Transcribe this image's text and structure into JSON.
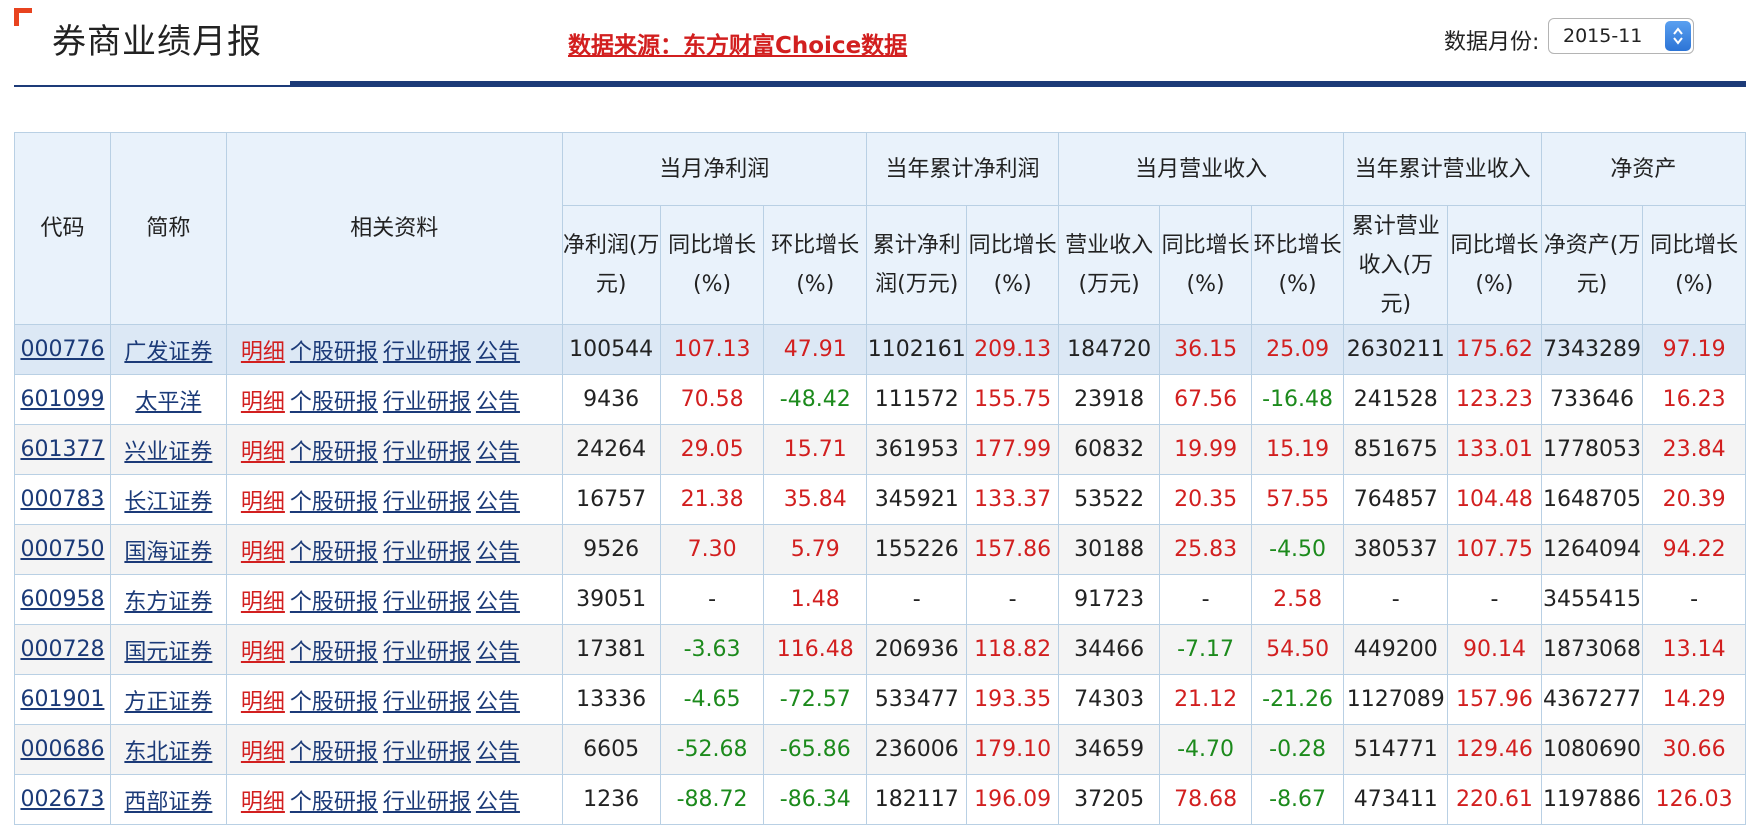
{
  "header": {
    "title": "券商业绩月报",
    "source_link": "数据来源：东方财富Choice数据",
    "month_label": "数据月份:",
    "month_value": "2015-11"
  },
  "colors": {
    "accent": "#1d3b78",
    "positive": "#d21f1f",
    "negative": "#1c8a1c",
    "header_bg": "#e9f2fb"
  },
  "table": {
    "group_headers": {
      "code": "代码",
      "name": "简称",
      "resources": "相关资料",
      "monthly_profit": "当月净利润",
      "ytd_profit": "当年累计净利润",
      "monthly_revenue": "当月营业收入",
      "ytd_revenue": "当年累计营业收入",
      "net_assets": "净资产"
    },
    "sub_headers": {
      "mp_value": "净利润(万元)",
      "mp_yoy": "同比增长(%)",
      "mp_mom": "环比增长(%)",
      "yp_value": "累计净利润(万元)",
      "yp_yoy": "同比增长(%)",
      "mr_value": "营业收入(万元)",
      "mr_yoy": "同比增长(%)",
      "mr_mom": "环比增长(%)",
      "yr_value": "累计营业收入(万元)",
      "yr_yoy": "同比增长(%)",
      "na_value": "净资产(万元)",
      "na_yoy": "同比增长(%)"
    },
    "resource_links": [
      "明细",
      "个股研报",
      "行业研报",
      "公告"
    ],
    "rows": [
      {
        "code": "000776",
        "name": "广发证券",
        "mp": "100544",
        "mp_yoy": "107.13",
        "mp_mom": "47.91",
        "yp": "1102161",
        "yp_yoy": "209.13",
        "mr": "184720",
        "mr_yoy": "36.15",
        "mr_mom": "25.09",
        "yr": "2630211",
        "yr_yoy": "175.62",
        "na": "7343289",
        "na_yoy": "97.19"
      },
      {
        "code": "601099",
        "name": "太平洋",
        "mp": "9436",
        "mp_yoy": "70.58",
        "mp_mom": "-48.42",
        "yp": "111572",
        "yp_yoy": "155.75",
        "mr": "23918",
        "mr_yoy": "67.56",
        "mr_mom": "-16.48",
        "yr": "241528",
        "yr_yoy": "123.23",
        "na": "733646",
        "na_yoy": "16.23"
      },
      {
        "code": "601377",
        "name": "兴业证券",
        "mp": "24264",
        "mp_yoy": "29.05",
        "mp_mom": "15.71",
        "yp": "361953",
        "yp_yoy": "177.99",
        "mr": "60832",
        "mr_yoy": "19.99",
        "mr_mom": "15.19",
        "yr": "851675",
        "yr_yoy": "133.01",
        "na": "1778053",
        "na_yoy": "23.84"
      },
      {
        "code": "000783",
        "name": "长江证券",
        "mp": "16757",
        "mp_yoy": "21.38",
        "mp_mom": "35.84",
        "yp": "345921",
        "yp_yoy": "133.37",
        "mr": "53522",
        "mr_yoy": "20.35",
        "mr_mom": "57.55",
        "yr": "764857",
        "yr_yoy": "104.48",
        "na": "1648705",
        "na_yoy": "20.39"
      },
      {
        "code": "000750",
        "name": "国海证券",
        "mp": "9526",
        "mp_yoy": "7.30",
        "mp_mom": "5.79",
        "yp": "155226",
        "yp_yoy": "157.86",
        "mr": "30188",
        "mr_yoy": "25.83",
        "mr_mom": "-4.50",
        "yr": "380537",
        "yr_yoy": "107.75",
        "na": "1264094",
        "na_yoy": "94.22"
      },
      {
        "code": "600958",
        "name": "东方证券",
        "mp": "39051",
        "mp_yoy": "-",
        "mp_mom": "1.48",
        "yp": "-",
        "yp_yoy": "-",
        "mr": "91723",
        "mr_yoy": "-",
        "mr_mom": "2.58",
        "yr": "-",
        "yr_yoy": "-",
        "na": "3455415",
        "na_yoy": "-"
      },
      {
        "code": "000728",
        "name": "国元证券",
        "mp": "17381",
        "mp_yoy": "-3.63",
        "mp_mom": "116.48",
        "yp": "206936",
        "yp_yoy": "118.82",
        "mr": "34466",
        "mr_yoy": "-7.17",
        "mr_mom": "54.50",
        "yr": "449200",
        "yr_yoy": "90.14",
        "na": "1873068",
        "na_yoy": "13.14"
      },
      {
        "code": "601901",
        "name": "方正证券",
        "mp": "13336",
        "mp_yoy": "-4.65",
        "mp_mom": "-72.57",
        "yp": "533477",
        "yp_yoy": "193.35",
        "mr": "74303",
        "mr_yoy": "21.12",
        "mr_mom": "-21.26",
        "yr": "1127089",
        "yr_yoy": "157.96",
        "na": "4367277",
        "na_yoy": "14.29"
      },
      {
        "code": "000686",
        "name": "东北证券",
        "mp": "6605",
        "mp_yoy": "-52.68",
        "mp_mom": "-65.86",
        "yp": "236006",
        "yp_yoy": "179.10",
        "mr": "34659",
        "mr_yoy": "-4.70",
        "mr_mom": "-0.28",
        "yr": "514771",
        "yr_yoy": "129.46",
        "na": "1080690",
        "na_yoy": "30.66"
      },
      {
        "code": "002673",
        "name": "西部证券",
        "mp": "1236",
        "mp_yoy": "-88.72",
        "mp_mom": "-86.34",
        "yp": "182117",
        "yp_yoy": "196.09",
        "mr": "37205",
        "mr_yoy": "78.68",
        "mr_mom": "-8.67",
        "yr": "473411",
        "yr_yoy": "220.61",
        "na": "1197886",
        "na_yoy": "126.03"
      }
    ]
  }
}
